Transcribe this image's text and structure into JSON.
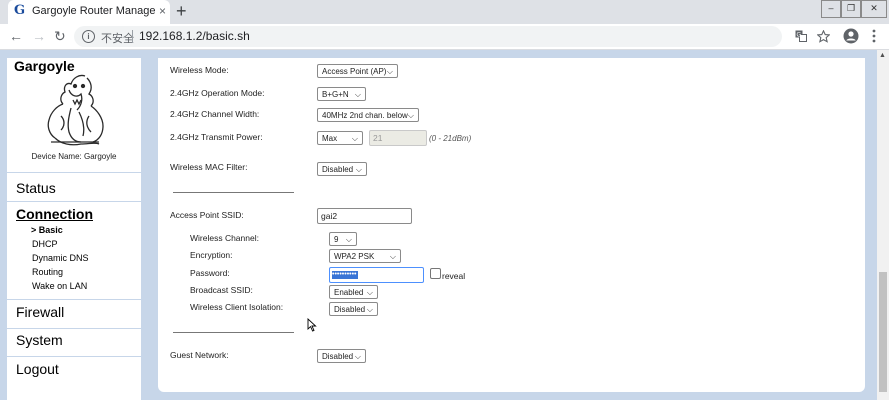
{
  "browser": {
    "tab_title": "Gargoyle Router Management",
    "favicon_letter": "G",
    "tab_close": "×",
    "new_tab": "+",
    "window_controls": [
      "–",
      "❐",
      "✕"
    ],
    "security_label": "不安全",
    "url": "192.168.1.2/basic.sh",
    "icons": [
      "back-arrow-icon",
      "forward-arrow-icon",
      "reload-icon",
      "info-icon",
      "translate-icon",
      "star-icon",
      "account-icon",
      "more-icon"
    ]
  },
  "sidebar": {
    "logo": "Gargoyle",
    "device_name": "Device Name: Gargoyle",
    "menu": {
      "status": "Status",
      "connection": "Connection",
      "firewall": "Firewall",
      "system": "System",
      "logout": "Logout"
    },
    "submenu": {
      "basic": "> Basic",
      "dhcp": "DHCP",
      "dynamic_dns": "Dynamic DNS",
      "routing": "Routing",
      "wake_on_lan": "Wake on LAN"
    }
  },
  "form": {
    "wireless_mode": {
      "label": "Wireless Mode:",
      "value": "Access Point (AP)"
    },
    "operation_mode": {
      "label": "2.4GHz Operation Mode:",
      "value": "B+G+N"
    },
    "channel_width": {
      "label": "2.4GHz Channel Width:",
      "value": "40MHz 2nd chan. below"
    },
    "transmit_power": {
      "label": "2.4GHz Transmit Power:",
      "value": "Max",
      "input_value": "21",
      "hint": "(0 - 21dBm)"
    },
    "mac_filter": {
      "label": "Wireless MAC Filter:",
      "value": "Disabled"
    },
    "ssid": {
      "label": "Access Point SSID:",
      "value": "gai2"
    },
    "channel": {
      "label": "Wireless Channel:",
      "value": "9"
    },
    "encryption": {
      "label": "Encryption:",
      "value": "WPA2 PSK"
    },
    "password": {
      "label": "Password:",
      "value": "••••••••••",
      "reveal_label": "reveal"
    },
    "broadcast_ssid": {
      "label": "Broadcast SSID:",
      "value": "Enabled"
    },
    "client_isolation": {
      "label": "Wireless Client Isolation:",
      "value": "Disabled"
    },
    "guest_network": {
      "label": "Guest Network:",
      "value": "Disabled"
    },
    "dropdown_arrow": "⌵"
  }
}
